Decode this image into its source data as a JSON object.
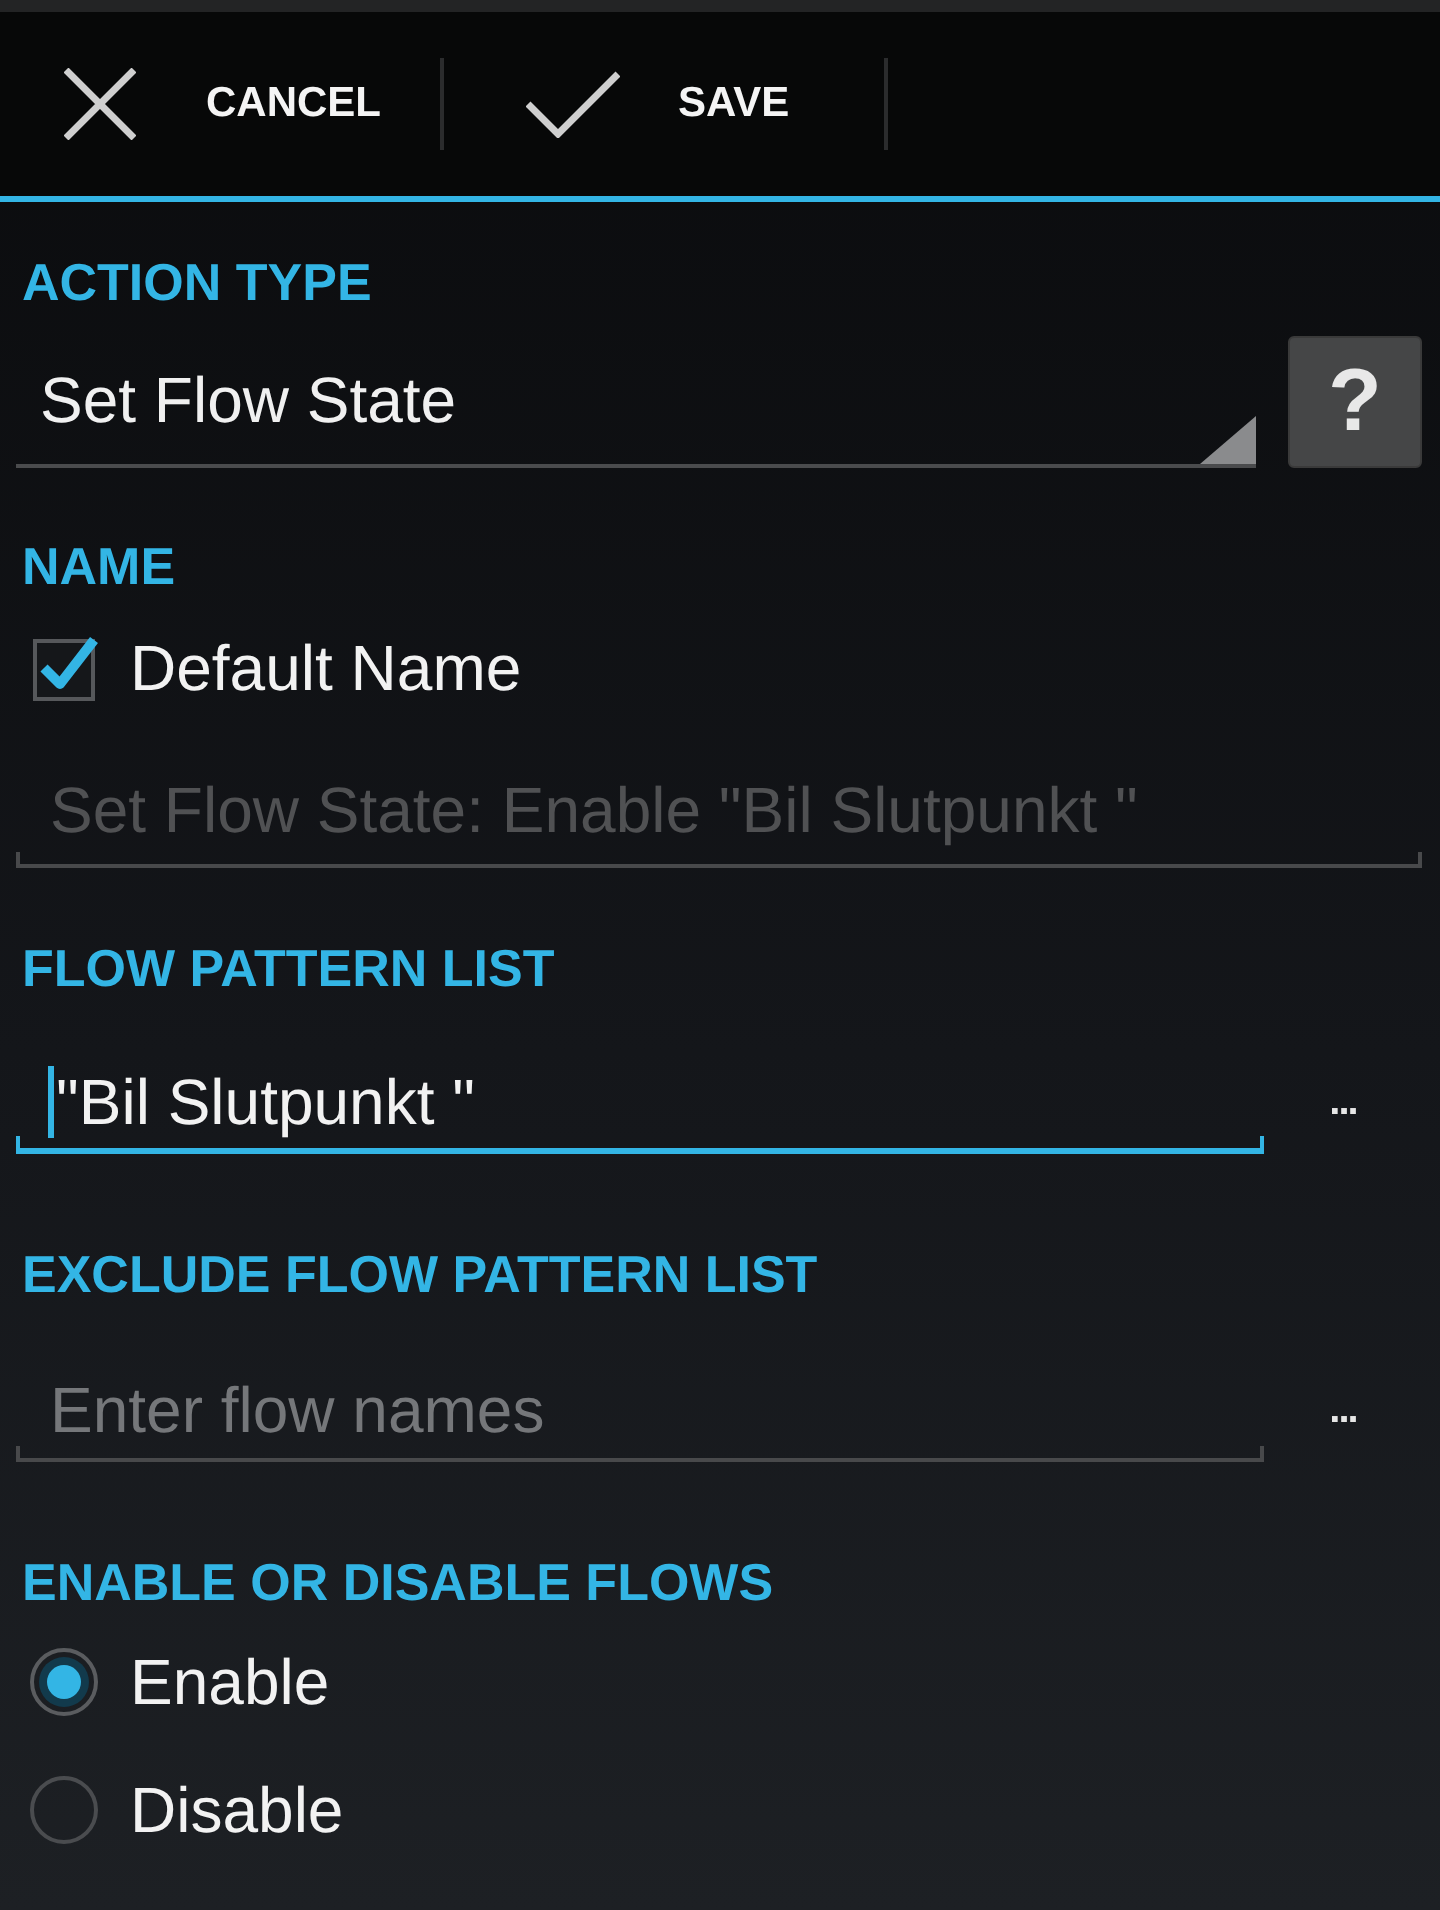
{
  "action_bar": {
    "buttons": [
      {
        "kind": "cancel",
        "label": "CANCEL"
      },
      {
        "kind": "save",
        "label": "SAVE"
      }
    ]
  },
  "action_type": {
    "label": "ACTION TYPE",
    "value": "Set Flow State",
    "help": "?"
  },
  "name": {
    "label": "NAME",
    "default_name": {
      "label": "Default Name",
      "checked": true
    },
    "field": {
      "value": "Set Flow State: Enable \"Bil Slutpunkt \"",
      "disabled": true
    }
  },
  "flow_pattern_list": {
    "label": "FLOW PATTERN LIST",
    "field": {
      "value": "\"Bil Slutpunkt \"",
      "focused": true
    },
    "more": "..."
  },
  "exclude_flow_pattern_list": {
    "label": "EXCLUDE FLOW PATTERN LIST",
    "field": {
      "placeholder": "Enter flow names",
      "focused": false
    },
    "more": "..."
  },
  "enable_or_disable_flows": {
    "label": "ENABLE OR DISABLE FLOWS",
    "options": [
      {
        "label": "Enable",
        "selected": true
      },
      {
        "label": "Disable",
        "selected": false
      }
    ]
  }
}
